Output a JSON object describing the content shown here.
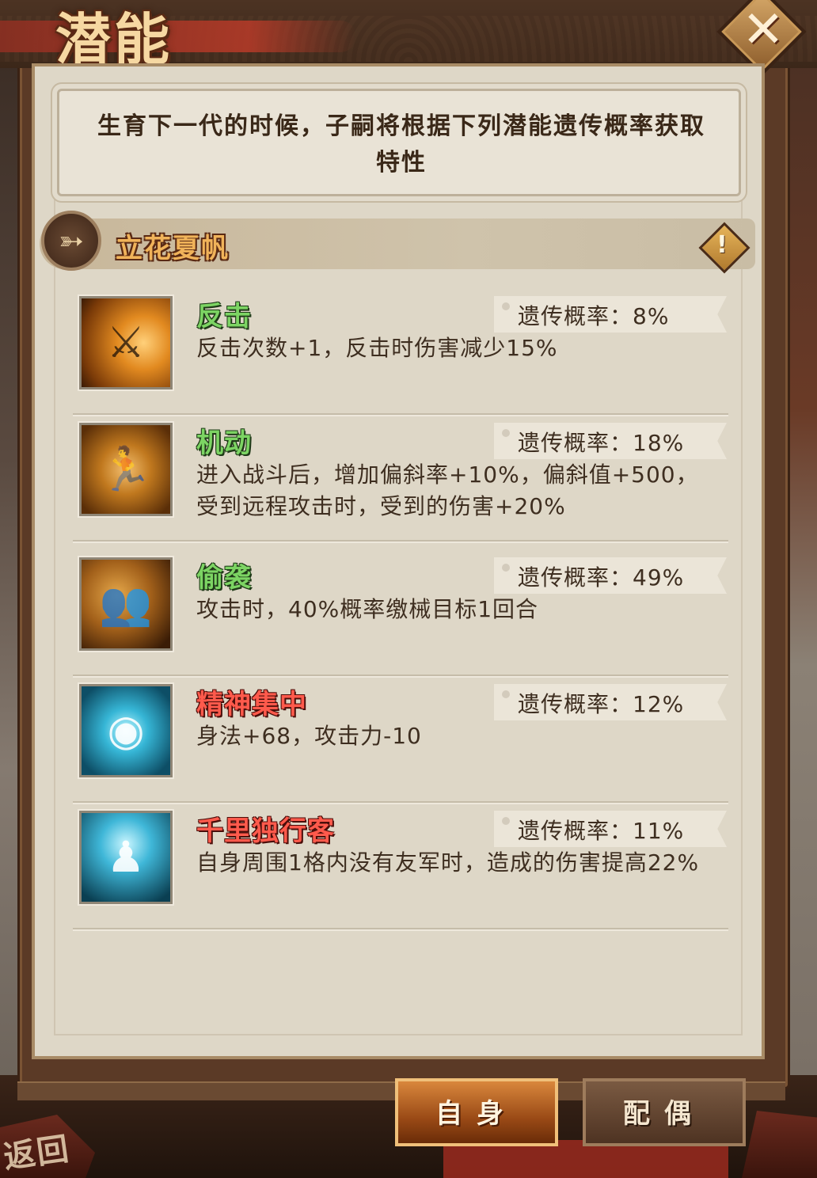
{
  "window": {
    "title": "潜能",
    "close_icon": "close-x-icon"
  },
  "description": "生育下一代的时候，子嗣将根据下列潜能遗传概率获取特性",
  "character": {
    "name": "立花夏帆",
    "emblem_icon": "shuriken-emblem-icon",
    "info_icon": "exclamation-icon",
    "info_label": "!"
  },
  "skills": [
    {
      "name": "反击",
      "name_color": "green",
      "rate_label": "遗传概率：8%",
      "description": "反击次数+1，反击时伤害减少15%",
      "icon": "counterattack-sword-icon"
    },
    {
      "name": "机动",
      "name_color": "green",
      "rate_label": "遗传概率：18%",
      "description": "进入战斗后，增加偏斜率+10%，偏斜值+500，受到远程攻击时，受到的伤害+20%",
      "icon": "running-ninja-icon"
    },
    {
      "name": "偷袭",
      "name_color": "green",
      "rate_label": "遗传概率：49%",
      "description": "攻击时，40%概率缴械目标1回合",
      "icon": "ambush-shadow-icon"
    },
    {
      "name": "精神集中",
      "name_color": "red",
      "rate_label": "遗传概率：12%",
      "description": "身法+68，攻击力-10",
      "icon": "eye-focus-icon"
    },
    {
      "name": "千里独行客",
      "name_color": "red",
      "rate_label": "遗传概率：11%",
      "description": "自身周围1格内没有友军时，造成的伤害提高22%",
      "icon": "lone-warrior-icon"
    }
  ],
  "tabs": {
    "self_label": "自身",
    "mate_label": "配偶",
    "active": "self"
  },
  "background": {
    "back_label": "返回"
  },
  "colors": {
    "panel_bg": "#ded7c7",
    "title": "#f6d8a2",
    "name_green": "#7cd463",
    "name_red": "#ff5a4c",
    "tab_active": "#d9873c"
  }
}
